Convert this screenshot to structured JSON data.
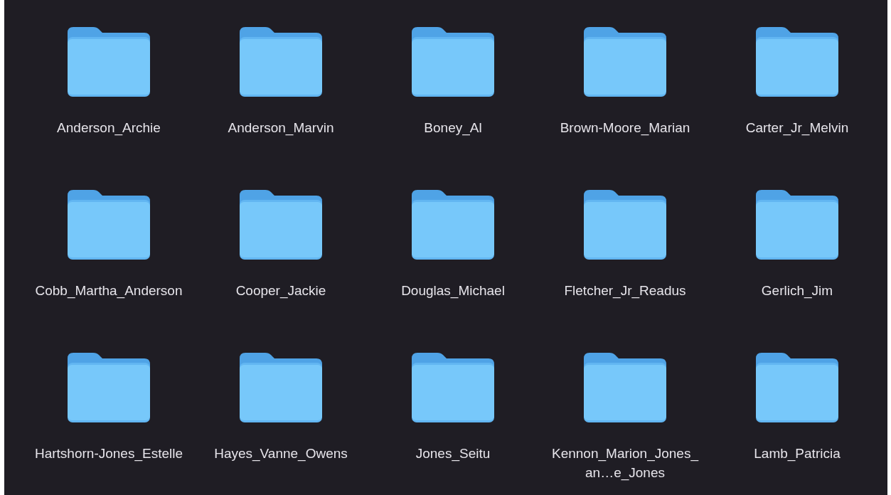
{
  "folders": [
    {
      "name": "Anderson_Archie"
    },
    {
      "name": "Anderson_Marvin"
    },
    {
      "name": "Boney_Al"
    },
    {
      "name": "Brown-Moore_Marian"
    },
    {
      "name": "Carter_Jr_Melvin"
    },
    {
      "name": "Cobb_Martha_Anderson"
    },
    {
      "name": "Cooper_Jackie"
    },
    {
      "name": "Douglas_Michael"
    },
    {
      "name": "Fletcher_Jr_Readus"
    },
    {
      "name": "Gerlich_Jim"
    },
    {
      "name": "Hartshorn-Jones_Estelle"
    },
    {
      "name": "Hayes_Vanne_Owens"
    },
    {
      "name": "Jones_Seitu"
    },
    {
      "name": "Kennon_Marion_Jones_an…e_Jones"
    },
    {
      "name": "Lamb_Patricia"
    }
  ]
}
